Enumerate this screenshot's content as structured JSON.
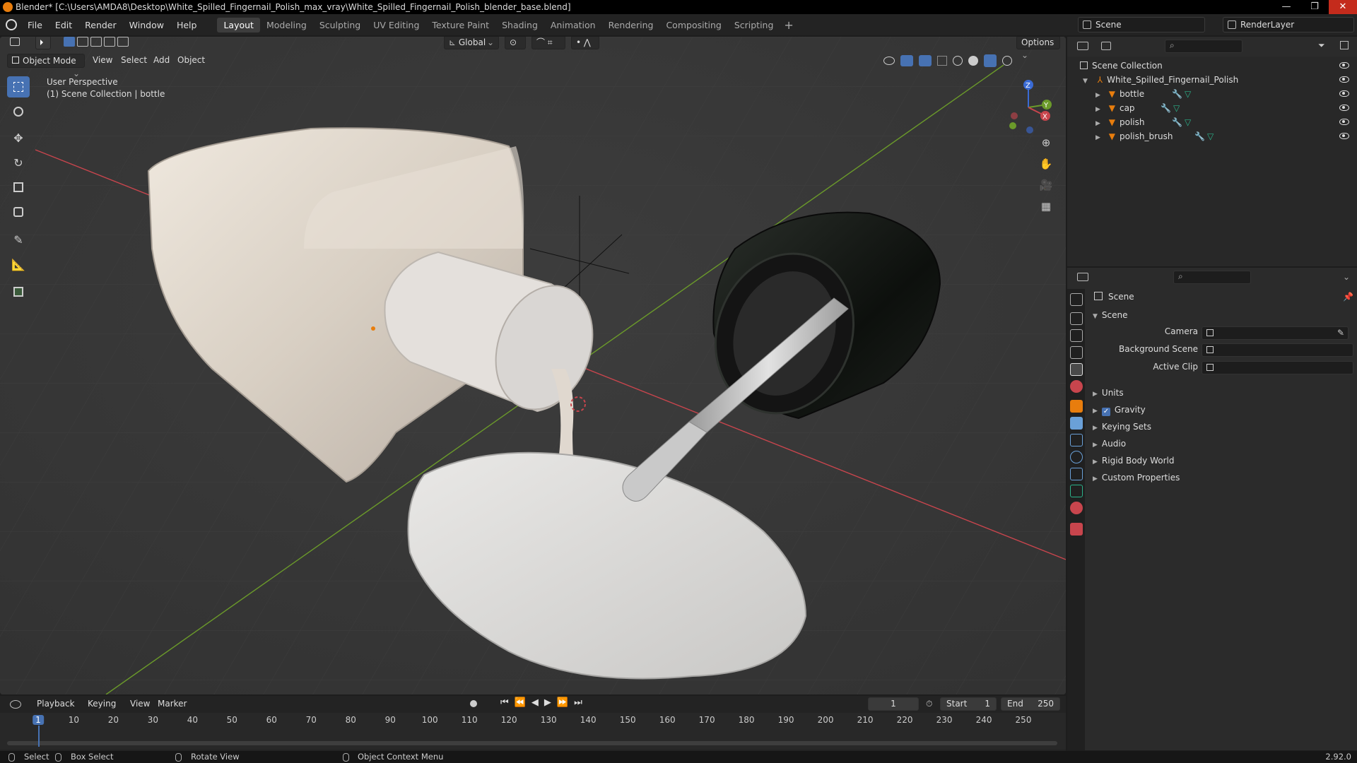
{
  "window": {
    "title": "Blender* [C:\\Users\\AMDA8\\Desktop\\White_Spilled_Fingernail_Polish_max_vray\\White_Spilled_Fingernail_Polish_blender_base.blend]",
    "minimize": "—",
    "maximize": "❐",
    "close": "✕"
  },
  "menu": [
    "File",
    "Edit",
    "Render",
    "Window",
    "Help"
  ],
  "workspaces": [
    "Layout",
    "Modeling",
    "Sculpting",
    "UV Editing",
    "Texture Paint",
    "Shading",
    "Animation",
    "Rendering",
    "Compositing",
    "Scripting"
  ],
  "workspace_add": "+",
  "scene_name": "Scene",
  "render_layer": "RenderLayer",
  "viewport": {
    "transform_orientation": "Global",
    "options_label": "Options",
    "mode": "Object Mode",
    "header_menus": [
      "View",
      "Select",
      "Add",
      "Object"
    ],
    "perspective_label": "User Perspective",
    "collection_label": "(1) Scene Collection | bottle",
    "gizmo_axes": {
      "x": "X",
      "y": "Y",
      "z": "Z"
    }
  },
  "outliner": {
    "root": "Scene Collection",
    "collection": "White_Spilled_Fingernail_Polish",
    "objects": [
      "bottle",
      "cap",
      "polish",
      "polish_brush"
    ]
  },
  "properties": {
    "context_title": "Scene",
    "panel_title": "Scene",
    "fields": [
      {
        "label": "Camera",
        "value": ""
      },
      {
        "label": "Background Scene",
        "value": ""
      },
      {
        "label": "Active Clip",
        "value": ""
      }
    ],
    "subpanels": [
      "Units",
      "Gravity",
      "Keying Sets",
      "Audio",
      "Rigid Body World",
      "Custom Properties"
    ],
    "gravity_checked": true
  },
  "timeline": {
    "menus": [
      "Playback",
      "Keying",
      "View",
      "Marker"
    ],
    "current_frame": "1",
    "start_label": "Start",
    "start": "1",
    "end_label": "End",
    "end": "250",
    "ticks": [
      "1",
      "10",
      "20",
      "30",
      "40",
      "50",
      "60",
      "70",
      "80",
      "90",
      "100",
      "110",
      "120",
      "130",
      "140",
      "150",
      "160",
      "170",
      "180",
      "190",
      "200",
      "210",
      "220",
      "230",
      "240",
      "250"
    ]
  },
  "status": {
    "select": "Select",
    "box_select": "Box Select",
    "rotate_view": "Rotate View",
    "context_menu": "Object Context Menu",
    "version": "2.92.0"
  },
  "colors": {
    "accent": "#4772b3",
    "object_orange": "#e87d0d",
    "axis_red": "#c8454d",
    "axis_green": "#6b9a2a",
    "close_red": "#c42b1c"
  }
}
